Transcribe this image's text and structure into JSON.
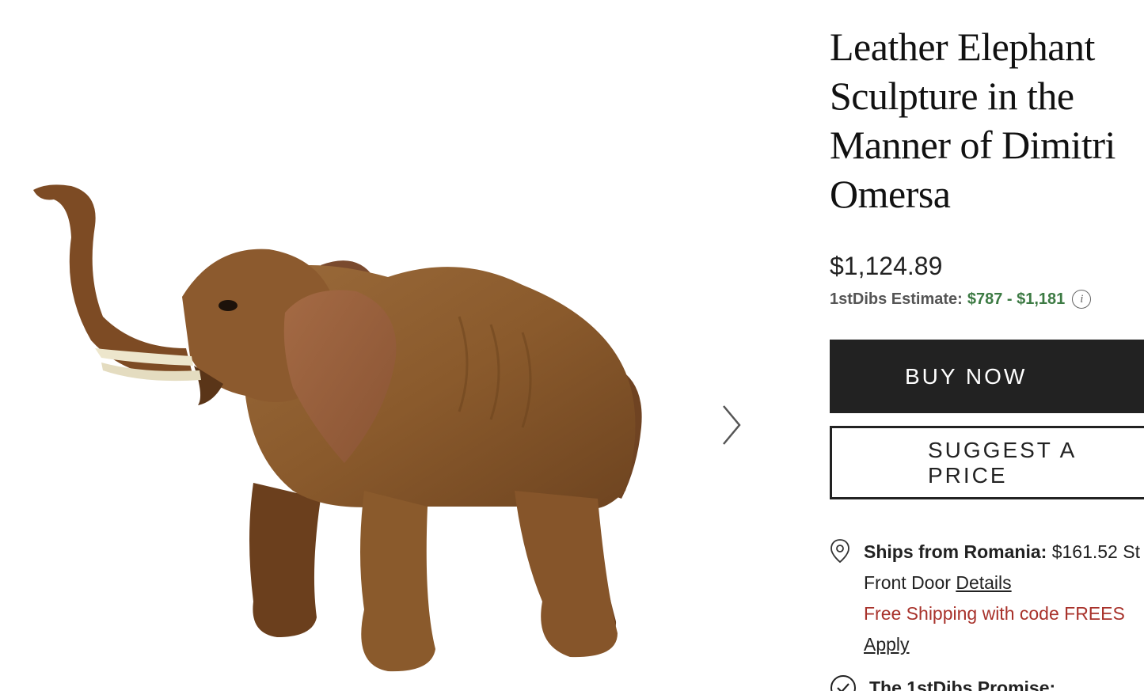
{
  "product": {
    "title": "Leather Elephant Sculpture in the Manner of Dimitri Omersa",
    "image_alt": "leather elephant sculpture with raised trunk"
  },
  "pricing": {
    "price": "$1,124.89",
    "estimate_label": "1stDibs Estimate:",
    "estimate_range": "$787 - $1,181"
  },
  "actions": {
    "buy_now": "BUY NOW",
    "suggest_price": "SUGGEST A PRICE"
  },
  "shipping": {
    "label": "Ships from Romania:",
    "cost": "$161.52 St",
    "method": "Front Door",
    "details_link": "Details",
    "promo": "Free Shipping with code FREES",
    "apply_link": "Apply"
  },
  "promise": {
    "label": "The 1stDibs Promise:"
  },
  "icons": {
    "next": "chevron-right-icon",
    "info": "info-icon",
    "location": "map-pin-icon",
    "check": "check-circle-icon"
  },
  "colors": {
    "estimate_green": "#3c7a43",
    "promo_red": "#a8322b",
    "button_dark": "#222222"
  }
}
